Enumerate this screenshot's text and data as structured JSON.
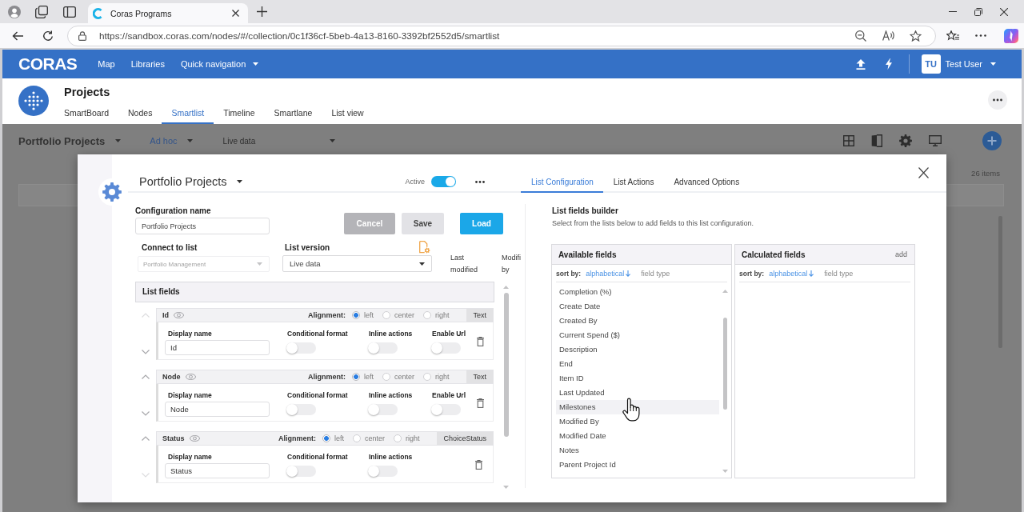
{
  "browser": {
    "tabs": [
      {
        "title": "Coras Programs",
        "selected": true
      }
    ],
    "url": "https://sandbox.coras.com/nodes/#/collection/0c1f36cf-5beb-4a13-8160-3392bf2552d5/smartlist"
  },
  "app_bar": {
    "logo": "CORAS",
    "menu": [
      {
        "label": "Map",
        "dropdown": false
      },
      {
        "label": "Libraries",
        "dropdown": false
      },
      {
        "label": "Quick navigation",
        "dropdown": true
      }
    ],
    "user": {
      "initials": "TU",
      "name": "Test User"
    }
  },
  "page": {
    "title": "Projects",
    "tabs": [
      {
        "label": "SmartBoard",
        "selected": false
      },
      {
        "label": "Nodes",
        "selected": false
      },
      {
        "label": "Smartlist",
        "selected": true
      },
      {
        "label": "Timeline",
        "selected": false
      },
      {
        "label": "Smartlane",
        "selected": false
      },
      {
        "label": "List view",
        "selected": false
      }
    ]
  },
  "list_toolbar": {
    "view": "Portfolio Projects",
    "mode": "Ad hoc",
    "source": "Live data",
    "count": "26 items"
  },
  "dialog": {
    "title": "Portfolio Projects",
    "active": {
      "label": "Active",
      "on": true
    },
    "tabs": [
      {
        "label": "List Configuration",
        "selected": true
      },
      {
        "label": "List Actions",
        "selected": false
      },
      {
        "label": "Advanced Options",
        "selected": false
      }
    ],
    "config_name": {
      "label": "Configuration name",
      "value": "Portfolio Projects"
    },
    "buttons": [
      {
        "label": "Cancel",
        "kind": "secondary"
      },
      {
        "label": "Save",
        "kind": "neutral"
      },
      {
        "label": "Load",
        "kind": "primary"
      }
    ],
    "connect_to_list": {
      "label": "Connect to list",
      "value": "Portfolio Management",
      "disabled": true
    },
    "list_version": {
      "label": "List version",
      "value": "Live data"
    },
    "column_headers": [
      {
        "label": "Last modified"
      },
      {
        "label": "Modifi by"
      }
    ],
    "list_fields": {
      "title": "List fields",
      "fields": [
        {
          "name": "Id",
          "type": "Text",
          "up_disabled": true,
          "down_disabled": false,
          "alignment": {
            "label": "Alignment:",
            "options": [
              {
                "label": "left",
                "selected": true
              },
              {
                "label": "center",
                "selected": false
              },
              {
                "label": "right",
                "selected": false
              }
            ]
          },
          "display_name": {
            "label": "Display name",
            "value": "Id"
          },
          "toggles": [
            {
              "label": "Conditional format",
              "on": false
            },
            {
              "label": "Inline actions",
              "on": false
            },
            {
              "label": "Enable Url",
              "on": false
            }
          ]
        },
        {
          "name": "Node",
          "type": "Text",
          "up_disabled": false,
          "down_disabled": false,
          "alignment": {
            "label": "Alignment:",
            "options": [
              {
                "label": "left",
                "selected": true
              },
              {
                "label": "center",
                "selected": false
              },
              {
                "label": "right",
                "selected": false
              }
            ]
          },
          "display_name": {
            "label": "Display name",
            "value": "Node"
          },
          "toggles": [
            {
              "label": "Conditional format",
              "on": false
            },
            {
              "label": "Inline actions",
              "on": false
            },
            {
              "label": "Enable Url",
              "on": false
            }
          ]
        },
        {
          "name": "Status",
          "type": "ChoiceStatus",
          "up_disabled": false,
          "down_disabled": true,
          "alignment": {
            "label": "Alignment:",
            "options": [
              {
                "label": "left",
                "selected": true
              },
              {
                "label": "center",
                "selected": false
              },
              {
                "label": "right",
                "selected": false
              }
            ]
          },
          "display_name": {
            "label": "Display name",
            "value": "Status"
          },
          "toggles": [
            {
              "label": "Conditional format",
              "on": false
            },
            {
              "label": "Inline actions",
              "on": false
            }
          ]
        }
      ]
    },
    "builder": {
      "title": "List fields builder",
      "description": "Select from the lists below to add fields to this list configuration.",
      "available": {
        "title": "Available fields",
        "sort_label": "sort by:",
        "sort_options": [
          {
            "label": "alphabetical",
            "selected": true
          },
          {
            "label": "field type",
            "selected": false
          }
        ],
        "items": [
          {
            "label": "Completion (%)",
            "hovered": false
          },
          {
            "label": "Create Date",
            "hovered": false
          },
          {
            "label": "Created By",
            "hovered": false
          },
          {
            "label": "Current Spend ($)",
            "hovered": false
          },
          {
            "label": "Description",
            "hovered": false
          },
          {
            "label": "End",
            "hovered": false
          },
          {
            "label": "Item ID",
            "hovered": false
          },
          {
            "label": "Last Updated",
            "hovered": false
          },
          {
            "label": "Milestones",
            "hovered": true
          },
          {
            "label": "Modified By",
            "hovered": false
          },
          {
            "label": "Modified Date",
            "hovered": false
          },
          {
            "label": "Notes",
            "hovered": false
          },
          {
            "label": "Parent Project Id",
            "hovered": false
          }
        ]
      },
      "calculated": {
        "title": "Calculated fields",
        "action": "add",
        "sort_label": "sort by:",
        "sort_options": [
          {
            "label": "alphabetical",
            "selected": true
          },
          {
            "label": "field type",
            "selected": false
          }
        ]
      }
    }
  }
}
